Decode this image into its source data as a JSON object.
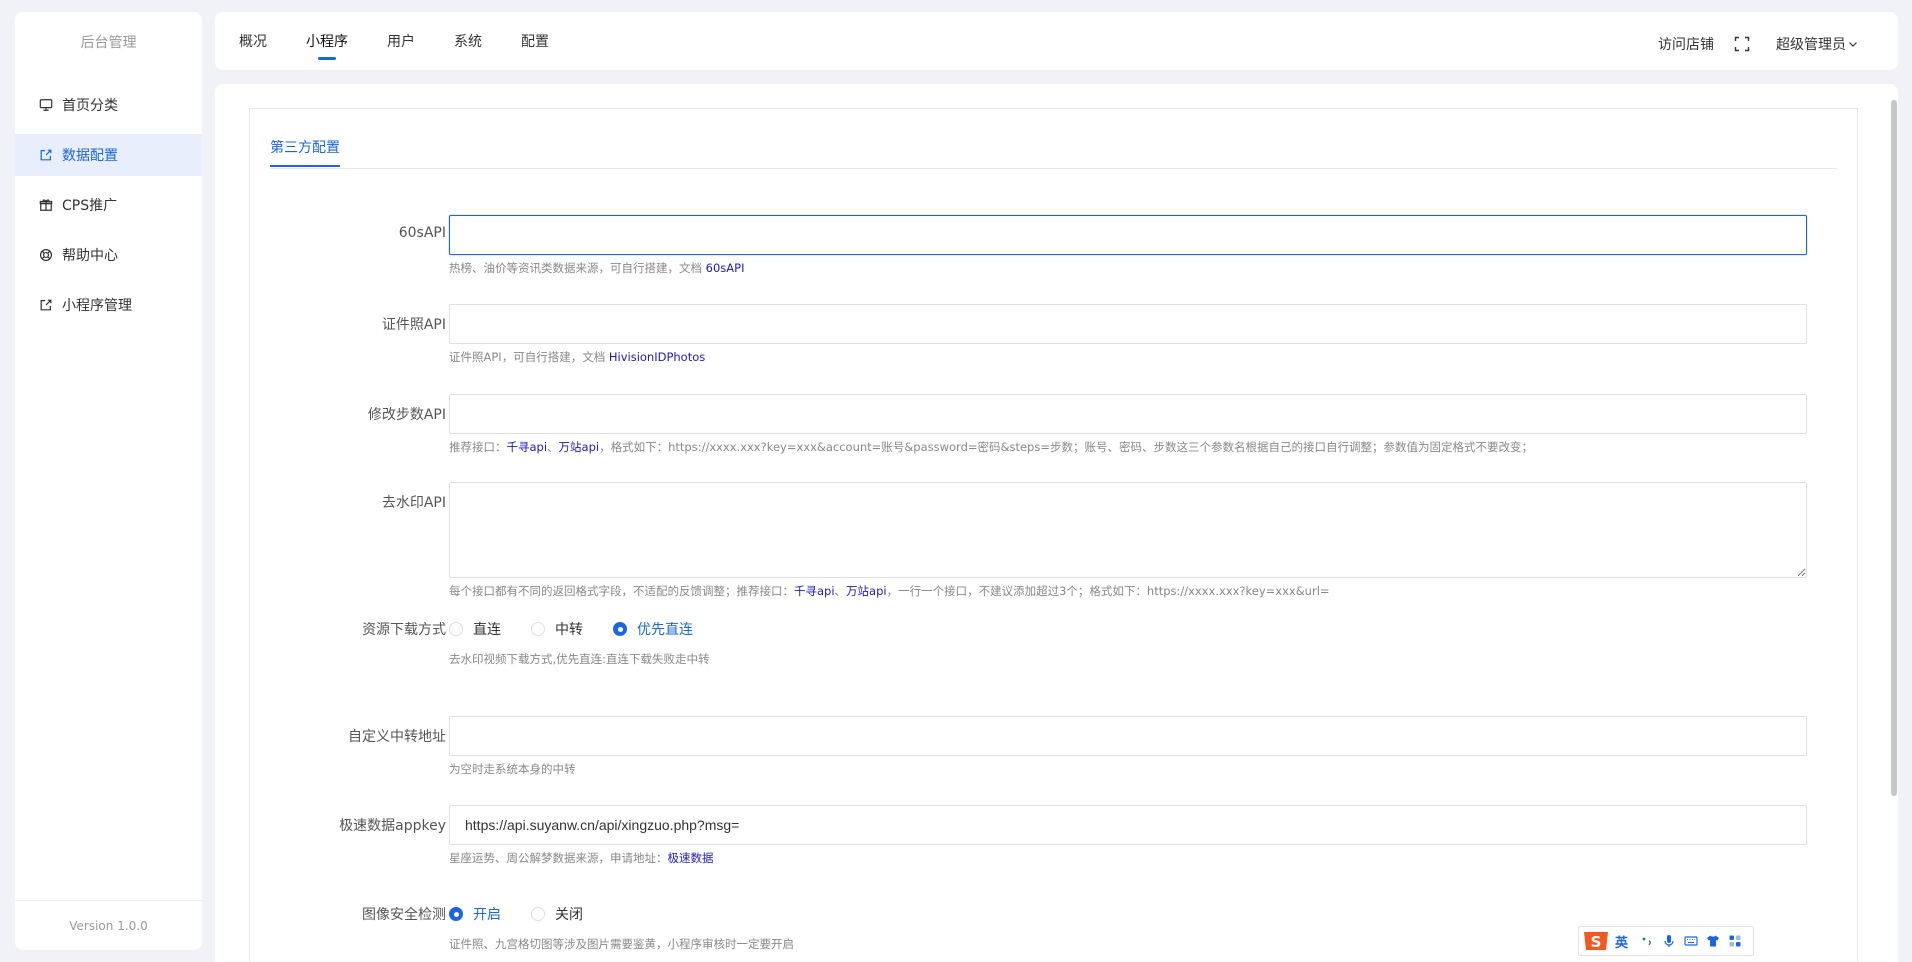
{
  "sidebar": {
    "brand": "后台管理",
    "items": [
      {
        "label": "首页分类",
        "icon": "monitor-icon"
      },
      {
        "label": "数据配置",
        "icon": "external-link-icon"
      },
      {
        "label": "CPS推广",
        "icon": "gift-icon"
      },
      {
        "label": "帮助中心",
        "icon": "lifebuoy-icon"
      },
      {
        "label": "小程序管理",
        "icon": "external-link-icon"
      }
    ],
    "active_index": 1,
    "version": "Version 1.0.0"
  },
  "topbar": {
    "tabs": [
      "概况",
      "小程序",
      "用户",
      "系统",
      "配置"
    ],
    "active_tab": "小程序",
    "visit_store": "访问店铺",
    "admin": "超级管理员"
  },
  "section": {
    "tab": "第三方配置"
  },
  "form": {
    "api60s": {
      "label": "60sAPI",
      "value": "",
      "help": "热榜、油价等资讯类数据来源，可自行搭建，文档 ",
      "help_link": "60sAPI"
    },
    "idphoto": {
      "label": "证件照API",
      "value": "",
      "help": "证件照API，可自行搭建，文档 ",
      "help_link": "HivisionIDPhotos"
    },
    "steps": {
      "label": "修改步数API",
      "value": "",
      "help_prefix": "推荐接口：",
      "help_link1": "千寻api",
      "help_sep": "、",
      "help_link2": "万站api",
      "help_suffix": "，格式如下：https://xxxx.xxx?key=xxx&account=账号&password=密码&steps=步数；账号、密码、步数这三个参数名根据自己的接口自行调整；参数值为固定格式不要改变；"
    },
    "watermark": {
      "label": "去水印API",
      "value": "",
      "help_prefix": "每个接口都有不同的返回格式字段，不适配的反馈调整；推荐接口：",
      "help_link1": "千寻api",
      "help_sep": "、",
      "help_link2": "万站api",
      "help_suffix": "，一行一个接口，不建议添加超过3个；格式如下：https://xxxx.xxx?key=xxx&url="
    },
    "download": {
      "label": "资源下载方式",
      "options": [
        "直连",
        "中转",
        "优先直连"
      ],
      "selected": "优先直连",
      "help": "去水印视频下载方式,优先直连:直连下载失败走中转"
    },
    "relay": {
      "label": "自定义中转地址",
      "value": "",
      "help": "为空时走系统本身的中转"
    },
    "appkey": {
      "label": "极速数据appkey",
      "value": "https://api.suyanw.cn/api/xingzuo.php?msg=",
      "help": "星座运势、周公解梦数据来源，申请地址：",
      "help_link": "极速数据"
    },
    "imagecheck": {
      "label": "图像安全检测",
      "options": [
        "开启",
        "关闭"
      ],
      "selected": "开启",
      "help": "证件照、九宫格切图等涉及图片需要鉴黄，小程序审核时一定要开启"
    }
  },
  "ime": {
    "lang": "英"
  },
  "colors": {
    "accent": "#1a66e0",
    "link": "#1a1ac8",
    "active_menu_bg": "#e8eefb"
  }
}
